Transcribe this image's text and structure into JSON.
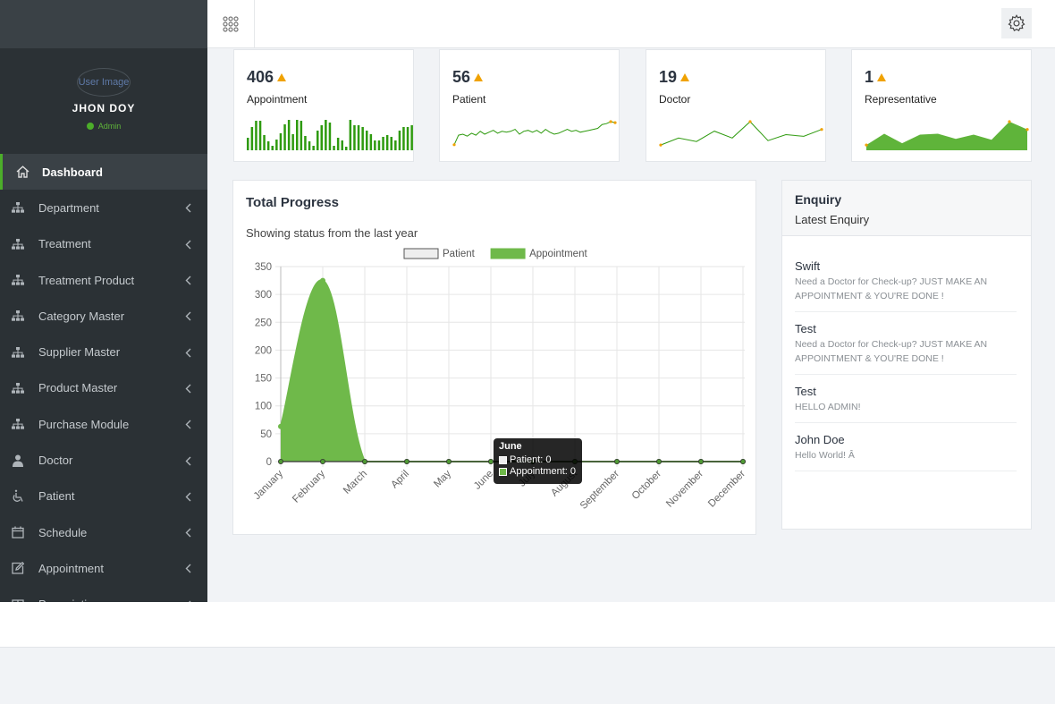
{
  "user": {
    "avatar_alt": "User Image",
    "name": "JHON DOY",
    "role": "Admin"
  },
  "nav": [
    {
      "label": "Dashboard",
      "icon": "home-icon"
    },
    {
      "label": "Department",
      "icon": "sitemap-icon"
    },
    {
      "label": "Treatment",
      "icon": "sitemap-icon"
    },
    {
      "label": "Treatment Product",
      "icon": "sitemap-icon"
    },
    {
      "label": "Category Master",
      "icon": "sitemap-icon"
    },
    {
      "label": "Supplier Master",
      "icon": "sitemap-icon"
    },
    {
      "label": "Product Master",
      "icon": "sitemap-icon"
    },
    {
      "label": "Purchase Module",
      "icon": "sitemap-icon"
    },
    {
      "label": "Doctor",
      "icon": "user-md-icon"
    },
    {
      "label": "Patient",
      "icon": "wheelchair-icon"
    },
    {
      "label": "Schedule",
      "icon": "calendar-icon"
    },
    {
      "label": "Appointment",
      "icon": "edit-icon"
    },
    {
      "label": "Prescription",
      "icon": "table-icon"
    }
  ],
  "stats": [
    {
      "value": "406",
      "label": "Appointment",
      "type": "bar",
      "color": "#2e9a0e",
      "series": [
        14,
        26,
        33,
        33,
        17,
        10,
        5,
        12,
        19,
        29,
        34,
        18,
        34,
        33,
        16,
        10,
        5,
        22,
        28,
        34,
        31,
        5,
        14,
        11,
        4,
        34,
        28,
        28,
        26,
        22,
        18,
        11,
        11,
        15,
        17,
        15,
        11,
        22,
        26,
        26,
        28
      ]
    },
    {
      "value": "56",
      "label": "Patient",
      "type": "line",
      "color": "#2e9a0e",
      "dot": "#f0a202",
      "series": [
        2,
        12,
        13,
        11,
        14,
        12,
        16,
        13,
        15,
        17,
        14,
        16,
        15,
        16,
        18,
        13,
        16,
        17,
        15,
        17,
        14,
        18,
        15,
        13,
        14,
        16,
        18,
        16,
        17,
        15,
        16,
        17,
        18,
        19,
        23,
        24,
        26,
        25
      ]
    },
    {
      "value": "19",
      "label": "Doctor",
      "type": "line",
      "color": "#2e9a0e",
      "dot": "#f0a202",
      "series": [
        2,
        10,
        6,
        18,
        10,
        29,
        7,
        14,
        12,
        20
      ]
    },
    {
      "value": "1",
      "label": "Representative",
      "type": "area",
      "color": "#5fb43a",
      "dot": "#f0a202",
      "series": [
        2,
        15,
        4,
        14,
        15,
        9,
        14,
        8,
        29,
        20
      ]
    }
  ],
  "total_progress": {
    "title": "Total Progress",
    "subtitle": "Showing status from the last year"
  },
  "chart_data": {
    "type": "area",
    "categories": [
      "January",
      "February",
      "March",
      "April",
      "May",
      "June",
      "July",
      "August",
      "September",
      "October",
      "November",
      "December"
    ],
    "series": [
      {
        "name": "Patient",
        "values": [
          0,
          0,
          0,
          0,
          0,
          0,
          0,
          0,
          0,
          0,
          0,
          0
        ],
        "color": "#eeeeee",
        "stroke": "#333333"
      },
      {
        "name": "Appointment",
        "values": [
          63,
          325,
          0,
          0,
          0,
          0,
          0,
          0,
          0,
          0,
          0,
          0
        ],
        "color": "#6fb94a",
        "stroke": "#6fb94a"
      }
    ],
    "yticks": [
      "350",
      "300",
      "250",
      "200",
      "150",
      "100",
      "50",
      "0"
    ],
    "ylim": [
      0,
      350
    ],
    "grid": true,
    "legend": "top"
  },
  "tooltip": {
    "title": "June",
    "rows": [
      {
        "label": "Patient: 0"
      },
      {
        "label": "Appointment: 0"
      }
    ]
  },
  "enquiry": {
    "title": "Enquiry",
    "subtitle": "Latest Enquiry",
    "items": [
      {
        "name": "Swift",
        "message": "Need a Doctor for Check-up? JUST MAKE AN APPOINTMENT & YOU'RE DONE !"
      },
      {
        "name": "Test",
        "message": "Need a Doctor for Check-up? JUST MAKE AN APPOINTMENT & YOU'RE DONE !"
      },
      {
        "name": "Test",
        "message": "HELLO ADMIN!"
      },
      {
        "name": "John Doe",
        "message": "Hello World! Â"
      }
    ]
  }
}
